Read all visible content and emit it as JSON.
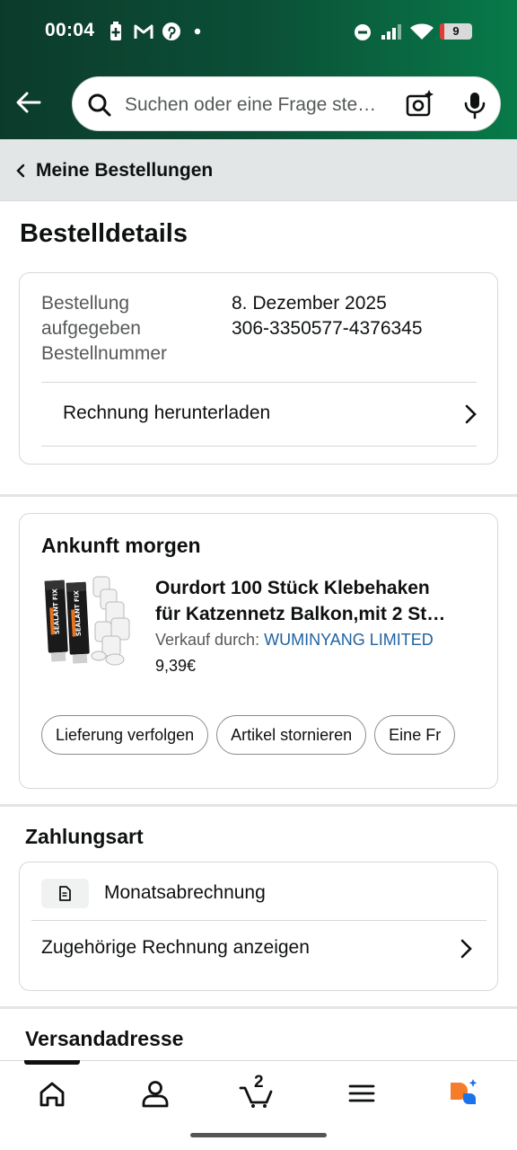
{
  "status_bar": {
    "time": "00:04",
    "battery": "9",
    "icons": [
      "battery-saver-icon",
      "gmail-icon",
      "pinterest-icon",
      "dot-icon",
      "dnd-icon",
      "signal-icon",
      "wifi-icon",
      "battery-icon"
    ]
  },
  "search": {
    "placeholder": "Suchen oder eine Frage ste…"
  },
  "breadcrumb": {
    "label": "Meine Bestellungen"
  },
  "page_title": "Bestelldetails",
  "order_info": {
    "placed_label_line1": "Bestellung",
    "placed_label_line2": "aufgegeben",
    "placed_value": "8. Dezember 2025",
    "number_label": "Bestellnummer",
    "number_value": "306-3350577-4376345",
    "invoice_link": "Rechnung herunterladen"
  },
  "shipment": {
    "title": "Ankunft morgen",
    "product_title_line1": "Ourdort 100 Stück Klebehaken",
    "product_title_line2": "für Katzennetz Balkon,mit 2 St…",
    "seller_label": "Verkauf durch:",
    "seller_name": "WUMINYANG LIMITED",
    "price": "9,39€",
    "image_text": "SEALANT FIX",
    "actions": [
      "Lieferung verfolgen",
      "Artikel stornieren",
      "Eine Fr"
    ]
  },
  "payment": {
    "title": "Zahlungsart",
    "method": "Monatsabrechnung",
    "invoice_link": "Zugehörige Rechnung anzeigen"
  },
  "shipping": {
    "title": "Versandadresse"
  },
  "bottom_nav": {
    "cart_count": "2",
    "items": [
      "home-icon",
      "account-icon",
      "cart-icon",
      "menu-icon",
      "rufus-icon"
    ]
  },
  "colors": {
    "header_gradient_start": "#0c3b2b",
    "header_gradient_end": "#087a49",
    "link": "#2162a1",
    "rufus_orange": "#f57c2a",
    "rufus_blue": "#1a73e8"
  }
}
